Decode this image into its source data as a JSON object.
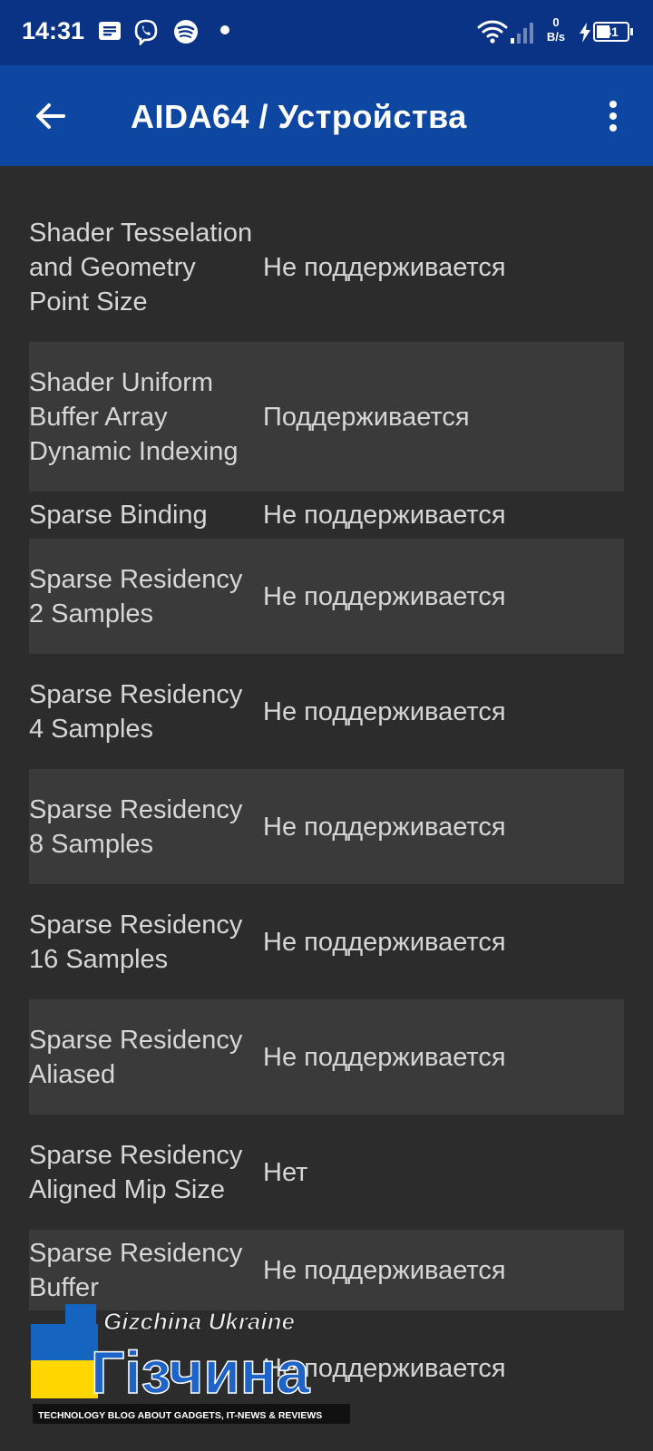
{
  "status_bar": {
    "time": "14:31",
    "icons": [
      "message-icon",
      "viber-icon",
      "spotify-icon",
      "notification-dot"
    ],
    "net_speed_value": "0",
    "net_speed_unit": "B/s",
    "battery_level": "41",
    "charging": true
  },
  "app_bar": {
    "title": "AIDA64  /  Устройства",
    "back_icon": "arrow-left-icon",
    "menu_icon": "more-vertical-icon"
  },
  "rows": [
    {
      "label": "Shader Tesselation and Geometry Point Size",
      "value": "Не поддерживается"
    },
    {
      "label": "Shader Uniform Buffer Array Dynamic Indexing",
      "value": "Поддерживается"
    },
    {
      "label": "Sparse Binding",
      "value": "Не поддерживается"
    },
    {
      "label": "Sparse Residency 2 Samples",
      "value": "Не поддерживается"
    },
    {
      "label": "Sparse Residency 4 Samples",
      "value": "Не поддерживается"
    },
    {
      "label": "Sparse Residency 8 Samples",
      "value": "Не поддерживается"
    },
    {
      "label": "Sparse Residency 16 Samples",
      "value": "Не поддерживается"
    },
    {
      "label": "Sparse Residency Aliased",
      "value": "Не поддерживается"
    },
    {
      "label": "Sparse Residency Aligned Mip Size",
      "value": "Нет"
    },
    {
      "label": "Sparse Residency Buffer",
      "value": "Не поддерживается"
    },
    {
      "label": "",
      "value": "Не поддерживается"
    }
  ],
  "watermark": {
    "brand": "Gizchina Ukraine",
    "logo_text": "Гізчина",
    "tagline": "TECHNOLOGY BLOG ABOUT GADGETS, IT-NEWS & REVIEWS"
  },
  "colors": {
    "status_bar": "#0a3386",
    "app_bar": "#0d47a1",
    "background": "#2c2c2c",
    "row_alt": "#3a3a3a",
    "text": "#d6d6d6"
  }
}
